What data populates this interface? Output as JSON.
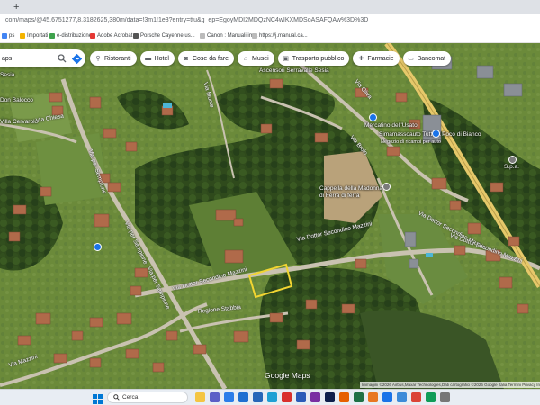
{
  "browser": {
    "new_tab": "+",
    "url": "com/maps/@45.6751277,8.3182625,380m/data=!3m1!1e3?entry=ttu&g_ep=EgoyMDI2MDQzNC4wIKXMDSoASAFQAw%3D%3D",
    "bookmarks": [
      {
        "label": "ps",
        "color": "#4285f4"
      },
      {
        "label": "Importati",
        "color": "#f4b400"
      },
      {
        "label": "e-distribuzione",
        "color": "#3fa34d"
      },
      {
        "label": "Adobe Acrobat",
        "color": "#e53935"
      },
      {
        "label": "Porsche Cayenne us...",
        "color": "#555555"
      },
      {
        "label": "Canon : Manuali im...",
        "color": "#bbbbbb"
      },
      {
        "label": "https://j.manual.ca...",
        "color": "#bbbbbb"
      }
    ]
  },
  "search": {
    "value": "aps"
  },
  "chips": [
    {
      "label": "Ristoranti",
      "icon": "fork-knife-icon",
      "glyph": "🍴"
    },
    {
      "label": "Hotel",
      "icon": "bed-icon",
      "glyph": "🛏"
    },
    {
      "label": "Cose da fare",
      "icon": "camera-icon",
      "glyph": "📷"
    },
    {
      "label": "Musei",
      "icon": "museum-icon",
      "glyph": "🏛"
    },
    {
      "label": "Trasporto pubblico",
      "icon": "bus-icon",
      "glyph": "🚌"
    },
    {
      "label": "Farmacie",
      "icon": "pharmacy-icon",
      "glyph": "💊"
    },
    {
      "label": "Bancomat",
      "icon": "atm-icon",
      "glyph": "💳"
    }
  ],
  "map": {
    "places": [
      {
        "name": "Asili Gattaguzzo di Serravalle Sesia",
        "label": "Ascensori Serravalle Sesia"
      },
      {
        "name": "mercatino",
        "label": "Mercatino dell'Usato"
      },
      {
        "name": "tutto-a-poco",
        "label": "Simamassoauto Tutto A Poco di Bianco"
      },
      {
        "name": "negozio",
        "label": "Negozio di ricambi per auto"
      },
      {
        "name": "cappella",
        "label": "Cappella della Madonna di Ferra di ferra"
      },
      {
        "name": "don-balocco",
        "label": "Don Balocco"
      },
      {
        "name": "sesia",
        "label": "Sesia"
      },
      {
        "name": "cervarolo",
        "label": "Villa Cervarolo"
      },
      {
        "name": "spa",
        "label": "S.p.a."
      }
    ],
    "roads": [
      {
        "id": "via-chiesa",
        "label": "Via Chiesa"
      },
      {
        "id": "via-brolo",
        "label": "Via Brolo"
      },
      {
        "id": "via-sempione-1",
        "label": "Via per Sempione"
      },
      {
        "id": "via-sempione-2",
        "label": "Via per Sempione"
      },
      {
        "id": "via-sempione-3",
        "label": "Via per Sempione"
      },
      {
        "id": "via-mazzini-1",
        "label": "Via Dottor Secondino Mazzini"
      },
      {
        "id": "via-mazzini-2",
        "label": "Via Dottor Secondino Mazzini"
      },
      {
        "id": "via-mazzini-3",
        "label": "Via Dottor Secondino Mazzini"
      },
      {
        "id": "via-mazzini-4",
        "label": "Via Dottor Secondino Mazzini"
      },
      {
        "id": "regione-stabbia",
        "label": "Regione Stabbia"
      },
      {
        "id": "via-oliva",
        "label": "Via Oliva"
      },
      {
        "id": "via-monte",
        "label": "Via Monte"
      },
      {
        "id": "via-mazzini-left",
        "label": "Via Mazzini"
      }
    ],
    "logo": "Google Maps",
    "attribution": "Immagini ©2026 Airbus,Maxar Technologies,Dati cartografici ©2026 Google   Italia   Termini   Privacy   Invia feedback sul prodotto   50 m",
    "highlight_color": "#f2d531"
  },
  "taskbar": {
    "search_label": "Cerca",
    "apps": [
      {
        "name": "file-explorer",
        "color": "#f4c542"
      },
      {
        "name": "teams",
        "color": "#5b5fc7"
      },
      {
        "name": "photos",
        "color": "#2b7de9"
      },
      {
        "name": "mail",
        "color": "#1f6fd1"
      },
      {
        "name": "store",
        "color": "#2766b8"
      },
      {
        "name": "edge",
        "color": "#1fa0d4"
      },
      {
        "name": "acrobat",
        "color": "#d9302c"
      },
      {
        "name": "word",
        "color": "#2b5bb8"
      },
      {
        "name": "onenote",
        "color": "#7a2fa2"
      },
      {
        "name": "photoshop",
        "color": "#0e1e4b"
      },
      {
        "name": "firefox",
        "color": "#e66000"
      },
      {
        "name": "excel",
        "color": "#1e7145"
      },
      {
        "name": "vlc",
        "color": "#e87722"
      },
      {
        "name": "app-blue",
        "color": "#1a73e8"
      },
      {
        "name": "tasks",
        "color": "#3d8bd8"
      },
      {
        "name": "chrome",
        "color": "#db4437"
      },
      {
        "name": "chrome-2",
        "color": "#0f9d58"
      },
      {
        "name": "settings",
        "color": "#777777"
      }
    ]
  }
}
